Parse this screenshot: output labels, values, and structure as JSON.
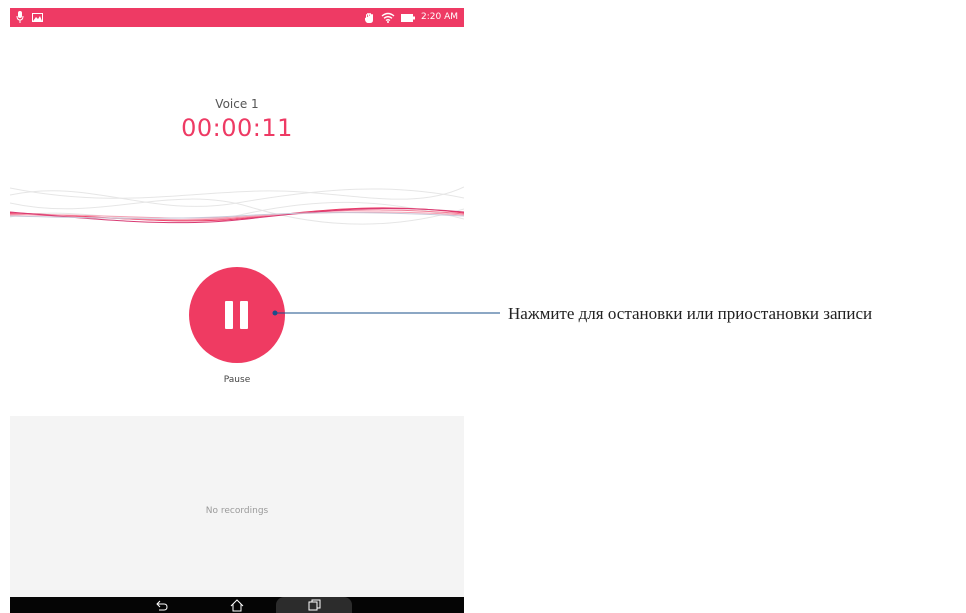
{
  "status_bar": {
    "time": "2:20 AM",
    "icons": [
      "microphone-icon",
      "image-icon",
      "hand-icon",
      "wifi-icon",
      "battery-icon"
    ],
    "background": "#ee3a64"
  },
  "recorder": {
    "title": "Voice 1",
    "elapsed": "00:00:11",
    "accent": "#ee3a64",
    "pause_label": "Pause"
  },
  "recordings": {
    "empty_text": "No recordings"
  },
  "nav_bar": {
    "icons": [
      "back-icon",
      "home-icon",
      "recent-apps-icon"
    ]
  },
  "callout": {
    "text": "Нажмите для остановки или приостановки записи",
    "line_color": "#1a4f8a"
  }
}
